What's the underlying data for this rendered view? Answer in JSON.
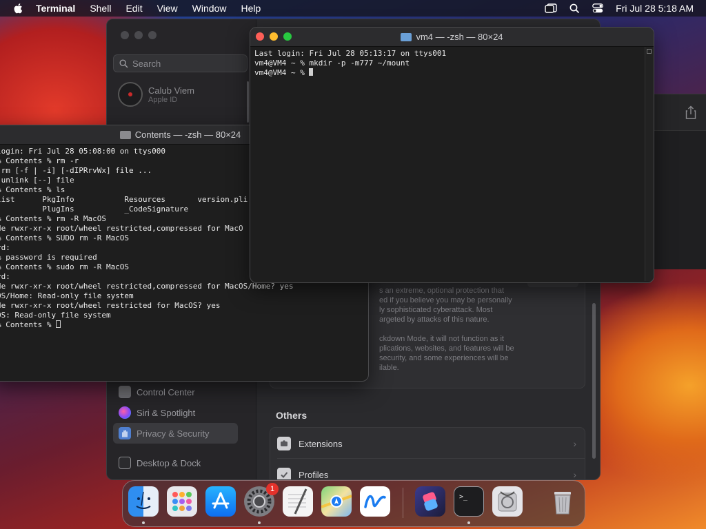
{
  "menubar": {
    "app_name": "Terminal",
    "menus": [
      "Shell",
      "Edit",
      "View",
      "Window",
      "Help"
    ],
    "clock": "Fri Jul 28  5:18 AM"
  },
  "settings": {
    "search_placeholder": "Search",
    "user_name": "Calub Viem",
    "user_sub": "Apple ID",
    "sidebar_items": [
      {
        "label": "Control Center",
        "icon": "control-center-icon"
      },
      {
        "label": "Siri & Spotlight",
        "icon": "siri-icon"
      },
      {
        "label": "Privacy & Security",
        "icon": "privacy-hand-icon",
        "selected": true
      },
      {
        "label": "Desktop & Dock",
        "icon": "desktop-dock-icon"
      }
    ],
    "lockdown_text": [
      "s an extreme, optional protection that",
      "ed if you believe you may be personally",
      "ly sophisticated cyberattack. Most",
      "argeted by attacks of this nature.",
      "",
      "ckdown Mode, it will not function as it",
      "plications, websites, and features will be",
      " security, and some experiences will be",
      "ilable."
    ],
    "others_title": "Others",
    "others_rows": [
      {
        "label": "Extensions",
        "icon": "extensions-icon"
      },
      {
        "label": "Profiles",
        "icon": "profiles-icon"
      }
    ]
  },
  "terminal_front": {
    "title": "vm4 — -zsh — 80×24",
    "lines": [
      "Last login: Fri Jul 28 05:13:17 on ttys001",
      "vm4@VM4 ~ % mkdir -p -m777 ~/mount"
    ],
    "prompt": "vm4@VM4 ~ % "
  },
  "terminal_back": {
    "title": "Contents — -zsh — 80×24",
    "lines": [
      "login: Fri Jul 28 05:08:00 on ttys000",
      "% Contents % rm -r",
      " rm [-f | -i] [-dIPRrvWx] file ...",
      " unlink [--] file",
      "% Contents % ls",
      "list      PkgInfo           Resources       version.pli",
      "          PlugIns           _CodeSignature",
      "% Contents % rm -R MacOS",
      "de rwxr-xr-x root/wheel restricted,compressed for MacO",
      "% Contents % SUDO rm -R MacOS",
      "rd:",
      "% password is required",
      "% Contents % sudo rm -R MacOS",
      "rd:",
      "de rwxr-xr-x root/wheel restricted,compressed for MacOS/Home? yes",
      "OS/Home: Read-only file system",
      "de rwxr-xr-x root/wheel restricted for MacOS? yes",
      "OS: Read-only file system"
    ],
    "prompt": "% Contents % "
  },
  "dock": {
    "items": [
      {
        "name": "Finder",
        "icon": "finder-icon",
        "color": "#2f8ef0",
        "running": true
      },
      {
        "name": "Launchpad",
        "icon": "launchpad-icon",
        "color": "#e8e8ec",
        "running": false
      },
      {
        "name": "App Store",
        "icon": "app-store-icon",
        "color": "#1a8cff",
        "running": false
      },
      {
        "name": "System Settings",
        "icon": "system-settings-icon",
        "color": "#8b8b90",
        "running": true,
        "badge": "1"
      },
      {
        "name": "TextEdit",
        "icon": "textedit-icon",
        "color": "#f2f2f2",
        "running": false
      },
      {
        "name": "Maps",
        "icon": "maps-icon",
        "color": "#5bc26a",
        "running": false
      },
      {
        "name": "Freeform",
        "icon": "freeform-icon",
        "color": "#ffffff",
        "running": false
      },
      {
        "name": "Shortcuts",
        "icon": "shortcuts-icon",
        "color": "#7a43e0",
        "running": false
      },
      {
        "name": "Terminal",
        "icon": "terminal-icon",
        "color": "#1d1d1f",
        "running": true
      },
      {
        "name": "Disk Utility",
        "icon": "disk-utility-icon",
        "color": "#e4e4e8",
        "running": false
      },
      {
        "name": "Trash",
        "icon": "trash-icon",
        "color": "#bfbfc4",
        "running": false
      }
    ]
  }
}
